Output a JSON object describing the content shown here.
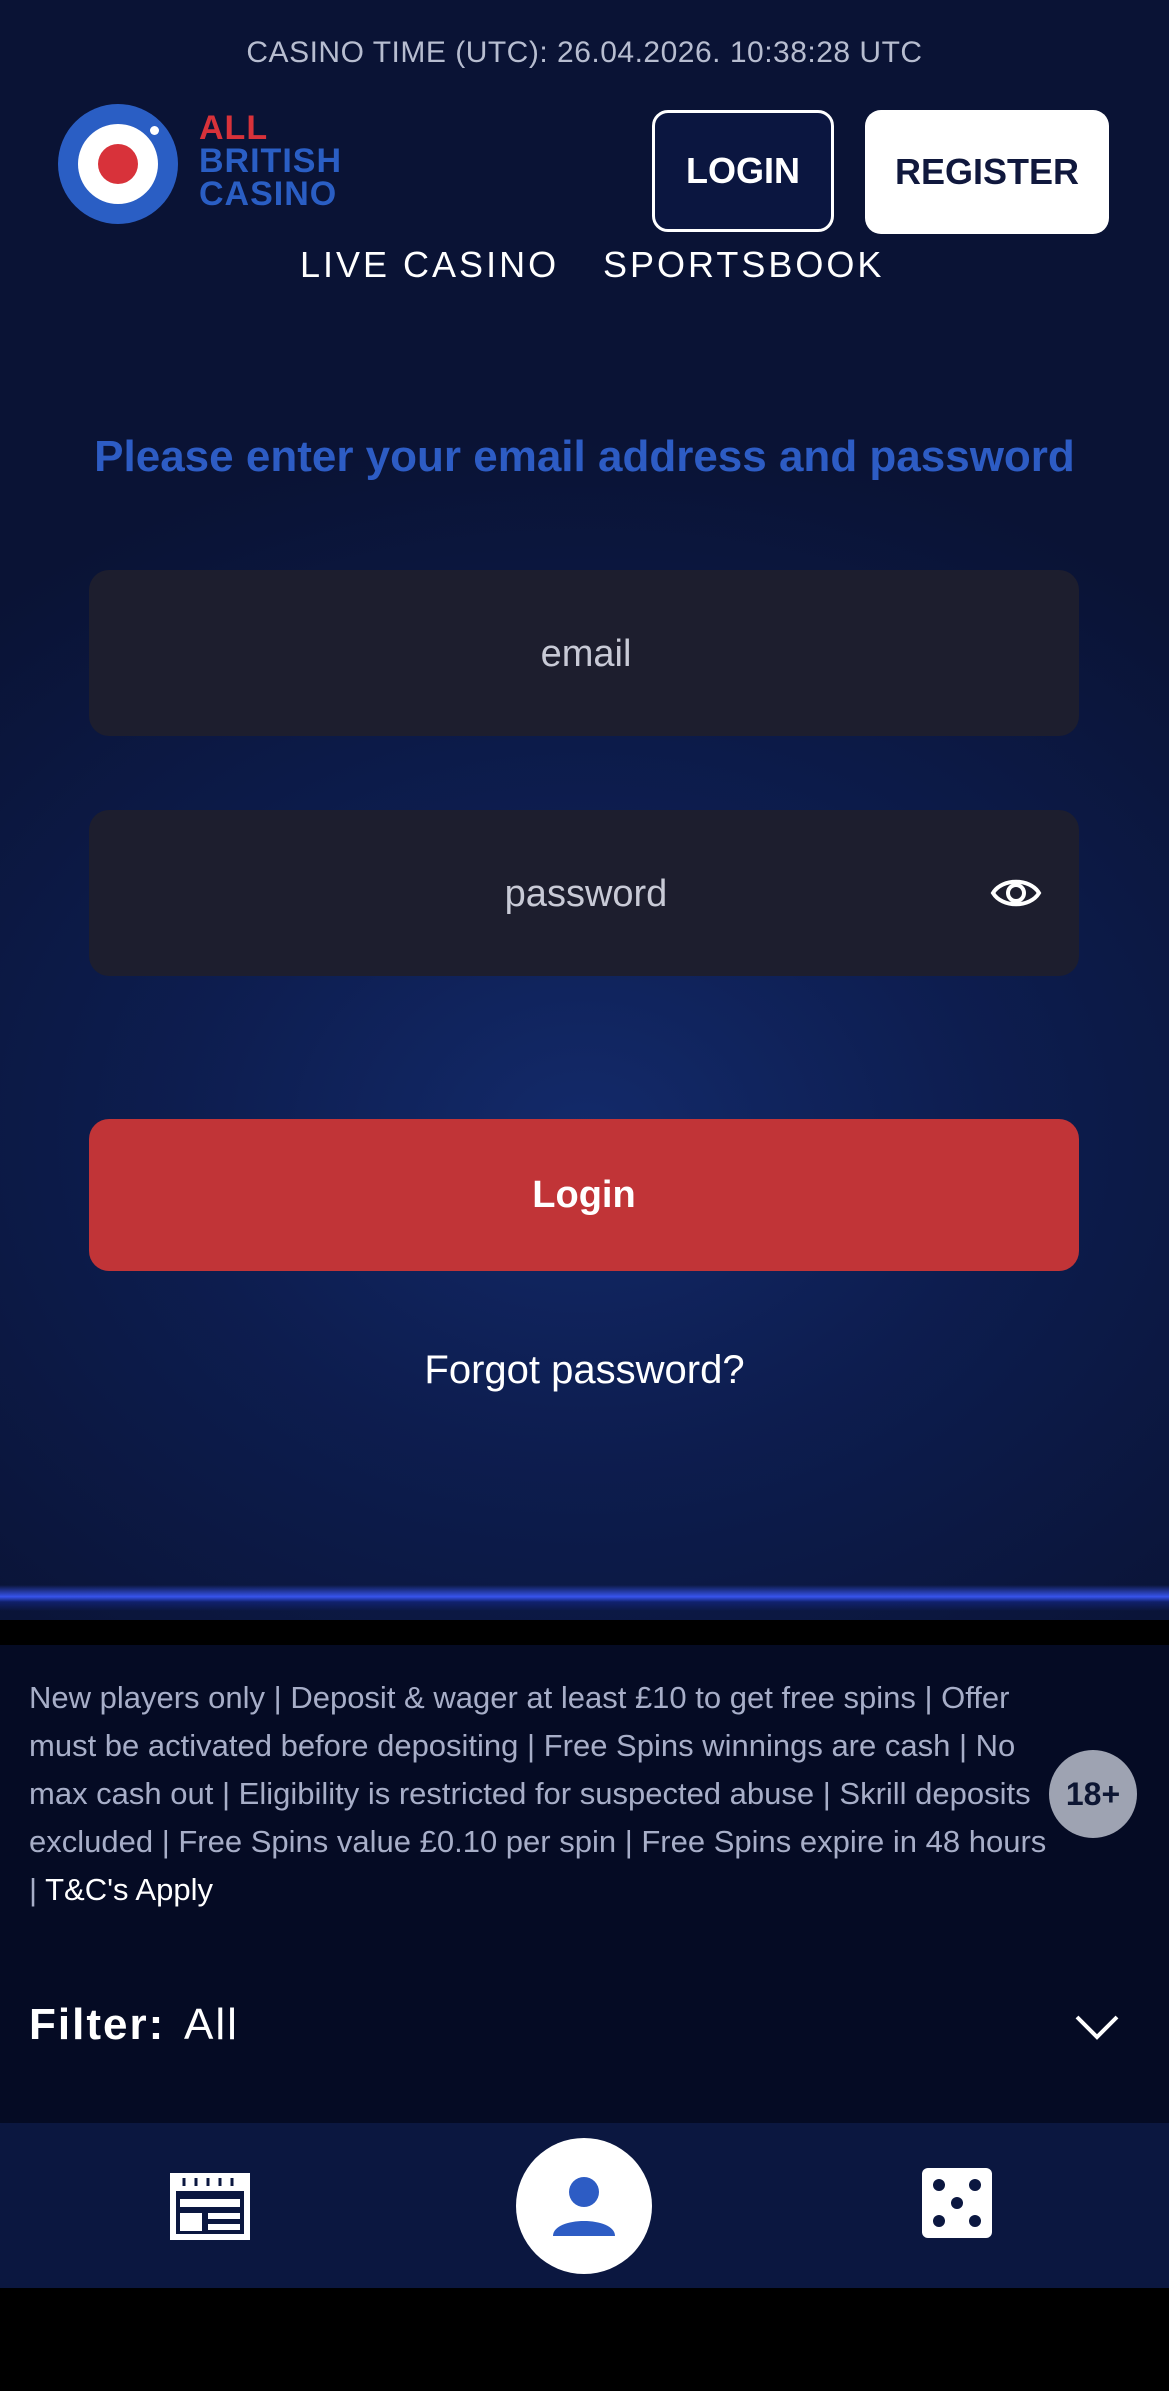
{
  "header": {
    "casino_time": "CASINO TIME (UTC): 26.04.2026. 10:38:28 UTC",
    "logo": {
      "line1": "ALL",
      "line2": "BRITISH",
      "line3": "CASINO"
    },
    "login_label": "LOGIN",
    "register_label": "REGISTER",
    "nav": {
      "live_casino": "LIVE CASINO",
      "sportsbook": "SPORTSBOOK"
    }
  },
  "login_form": {
    "prompt": "Please enter your email address and password",
    "email_placeholder": "email",
    "password_placeholder": "password",
    "submit_label": "Login",
    "forgot_label": "Forgot password?"
  },
  "disclaimer": {
    "text": "New players only | Deposit & wager at least £10 to get free spins | Offer must be activated before depositing | Free Spins winnings are cash | No max cash out | Eligibility is restricted for suspected abuse | Skrill deposits excluded | Free Spins value £0.10 per spin | Free Spins expire in 48 hours | ",
    "tc_link": "T&C's Apply",
    "age_badge": "18+"
  },
  "filter": {
    "label": "Filter:",
    "value": "All"
  },
  "tabbar": {
    "icons": [
      "news-icon",
      "user-icon",
      "dice-icon"
    ]
  },
  "colors": {
    "accent_blue": "#2d5cc4",
    "login_red": "#c13437",
    "logo_red": "#d8323a"
  }
}
